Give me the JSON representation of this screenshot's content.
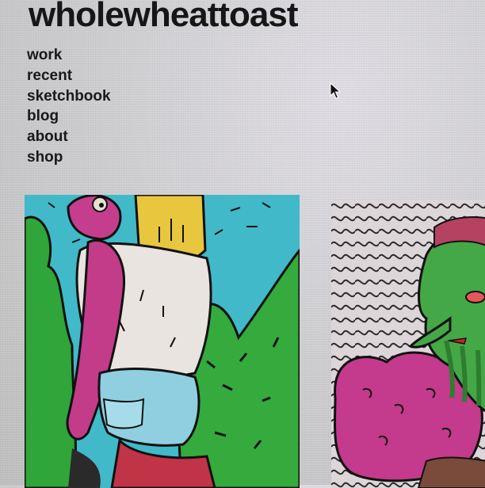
{
  "site": {
    "title": "wholewheattoast"
  },
  "nav": {
    "items": [
      {
        "label": "work"
      },
      {
        "label": "recent"
      },
      {
        "label": "sketchbook"
      },
      {
        "label": "blog"
      },
      {
        "label": "about"
      },
      {
        "label": "shop"
      }
    ]
  },
  "gallery": {
    "items": [
      {
        "description_icon": "illustration-thumbnail"
      },
      {
        "description_icon": "illustration-thumbnail"
      }
    ]
  },
  "colors": {
    "background": "#cfcfd0",
    "text": "#161616",
    "art_teal": "#3fb8c8",
    "art_green": "#2fa53a",
    "art_magenta": "#c23c8a",
    "art_yellow": "#e8c63e"
  }
}
